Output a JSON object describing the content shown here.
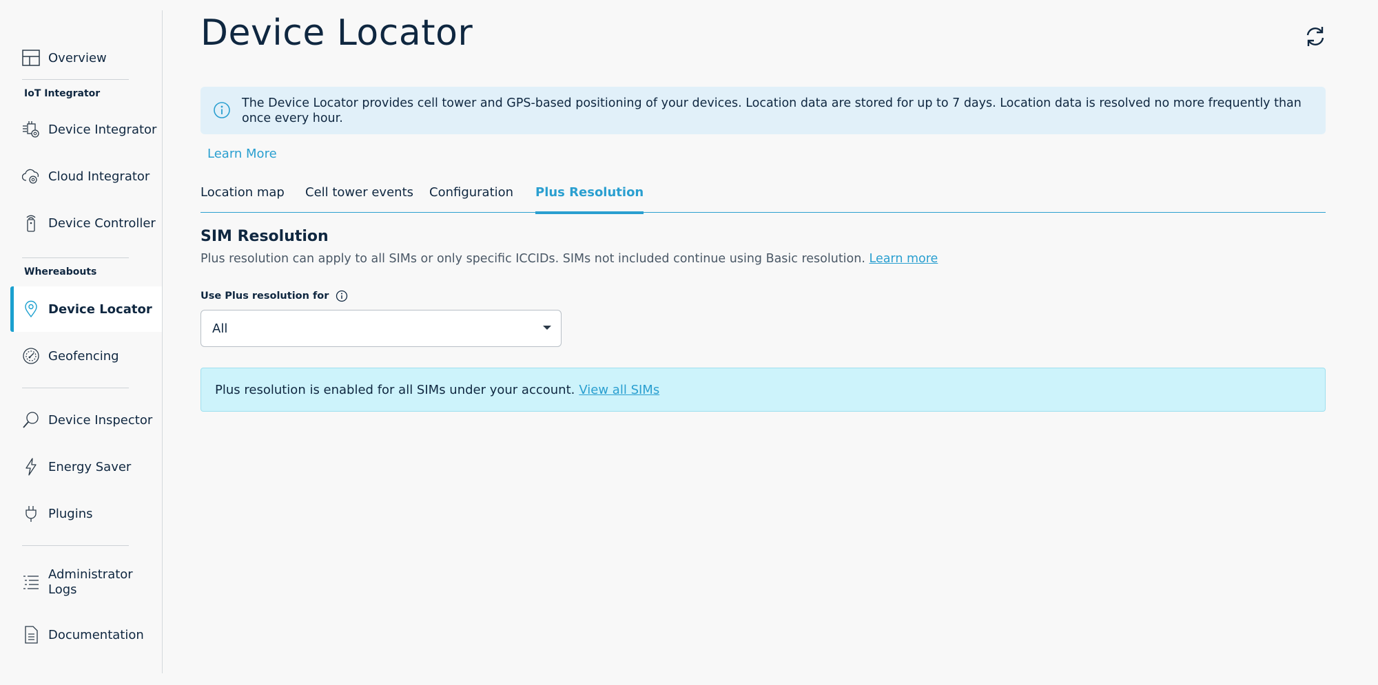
{
  "sidebar": {
    "items": [
      {
        "label": "Overview",
        "icon": "layout-icon"
      },
      {
        "label": "Device Integrator",
        "icon": "device-integrator-icon"
      },
      {
        "label": "Cloud Integrator",
        "icon": "cloud-gear-icon"
      },
      {
        "label": "Device Controller",
        "icon": "remote-control-icon"
      },
      {
        "label": "Device Locator",
        "icon": "map-pin-icon"
      },
      {
        "label": "Geofencing",
        "icon": "geofence-icon"
      },
      {
        "label": "Device Inspector",
        "icon": "magnifier-icon"
      },
      {
        "label": "Energy Saver",
        "icon": "lightning-icon"
      },
      {
        "label": "Plugins",
        "icon": "plug-icon"
      },
      {
        "label_line1": "Administrator",
        "label_line2": "Logs",
        "icon": "list-icon"
      },
      {
        "label": "Documentation",
        "icon": "document-icon"
      }
    ],
    "sections": {
      "iot_integrator": "IoT Integrator",
      "whereabouts": "Whereabouts"
    }
  },
  "header": {
    "title": "Device Locator"
  },
  "info_banner": {
    "text": "The Device Locator provides cell tower and GPS-based positioning of your devices. Location data are stored for up to 7 days. Location data is resolved no more frequently than once every hour.",
    "learn_more": "Learn More"
  },
  "tabs": [
    {
      "label": "Location map"
    },
    {
      "label": "Cell tower events"
    },
    {
      "label": "Configuration"
    },
    {
      "label": "Plus Resolution"
    }
  ],
  "sim_resolution": {
    "title": "SIM Resolution",
    "description": "Plus resolution can apply to all SIMs or only specific ICCIDs. SIMs not included continue using Basic resolution.",
    "learn_more": "Learn more",
    "field_label": "Use Plus resolution for",
    "selected_value": "All"
  },
  "status_banner": {
    "text": "Plus resolution is enabled for all SIMs under your account.",
    "link": "View all SIMs"
  },
  "colors": {
    "accent": "#2a9fd0",
    "text": "#0f2740",
    "info_bg": "#e1f0f9",
    "status_bg": "#cdf3fb"
  }
}
